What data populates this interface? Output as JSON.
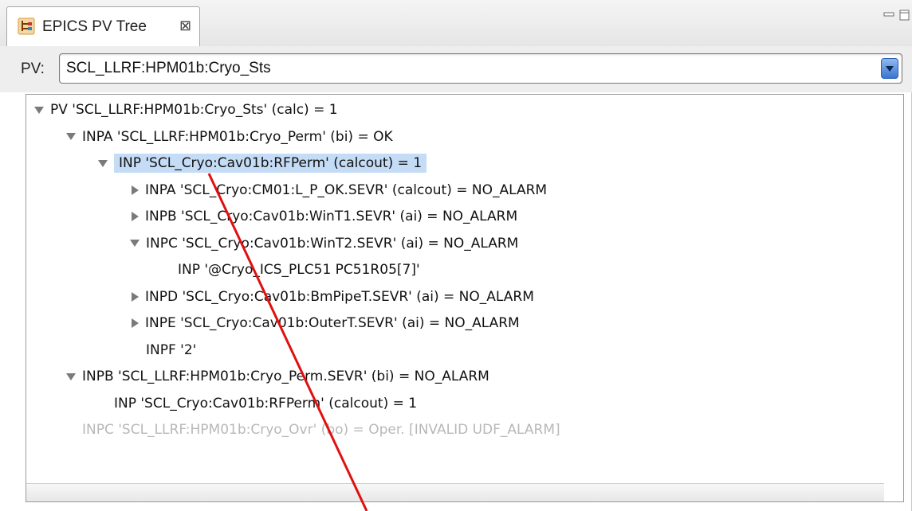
{
  "window": {
    "tab_title": "EPICS PV Tree",
    "tab_close_glyph": "⊠",
    "icons": [
      "pv-tree-app-icon",
      "close-icon",
      "minimize-icon",
      "maximize-icon",
      "chevron-down-icon"
    ]
  },
  "pv_field": {
    "label": "PV:",
    "value": "SCL_LLRF:HPM01b:Cryo_Sts"
  },
  "tree": [
    {
      "depth": 0,
      "expander": "open",
      "text": "PV 'SCL_LLRF:HPM01b:Cryo_Sts'  (calc)  =  1",
      "selected": false,
      "dim": false
    },
    {
      "depth": 1,
      "expander": "open",
      "text": "INPA 'SCL_LLRF:HPM01b:Cryo_Perm'  (bi)  =  OK",
      "selected": false,
      "dim": false
    },
    {
      "depth": 2,
      "expander": "open",
      "text": "INP 'SCL_Cryo:Cav01b:RFPerm'  (calcout)  =  1",
      "selected": true,
      "dim": false
    },
    {
      "depth": 3,
      "expander": "closed",
      "text": "INPA 'SCL_Cryo:CM01:L_P_OK.SEVR'  (calcout)  =  NO_ALARM",
      "selected": false,
      "dim": false
    },
    {
      "depth": 3,
      "expander": "closed",
      "text": "INPB 'SCL_Cryo:Cav01b:WinT1.SEVR'  (ai)  =  NO_ALARM",
      "selected": false,
      "dim": false
    },
    {
      "depth": 3,
      "expander": "open",
      "text": "INPC 'SCL_Cryo:Cav01b:WinT2.SEVR'  (ai)  =  NO_ALARM",
      "selected": false,
      "dim": false
    },
    {
      "depth": 4,
      "expander": "none",
      "text": "INP '@Cryo_ICS_PLC51 PC51R05[7]'",
      "selected": false,
      "dim": false
    },
    {
      "depth": 3,
      "expander": "closed",
      "text": "INPD 'SCL_Cryo:Cav01b:BmPipeT.SEVR'  (ai)  =  NO_ALARM",
      "selected": false,
      "dim": false
    },
    {
      "depth": 3,
      "expander": "closed",
      "text": "INPE 'SCL_Cryo:Cav01b:OuterT.SEVR'  (ai)  =  NO_ALARM",
      "selected": false,
      "dim": false
    },
    {
      "depth": 3,
      "expander": "none",
      "text": "INPF '2'",
      "selected": false,
      "dim": false
    },
    {
      "depth": 1,
      "expander": "open",
      "text": "INPB 'SCL_LLRF:HPM01b:Cryo_Perm.SEVR'  (bi)  =  NO_ALARM",
      "selected": false,
      "dim": false
    },
    {
      "depth": 2,
      "expander": "none",
      "text": "INP 'SCL_Cryo:Cav01b:RFPerm'  (calcout)  =  1",
      "selected": false,
      "dim": false
    },
    {
      "depth": 1,
      "expander": "none",
      "text": "INPC 'SCL_LLRF:HPM01b:Cryo_Ovr'  (bo)  =  Oper. [INVALID UDF_ALARM]",
      "selected": false,
      "dim": true
    }
  ],
  "colors": {
    "annotation_arrow": "#e01010",
    "selection": "#c5dcf6",
    "disabled_text": "#b8b8b8"
  }
}
